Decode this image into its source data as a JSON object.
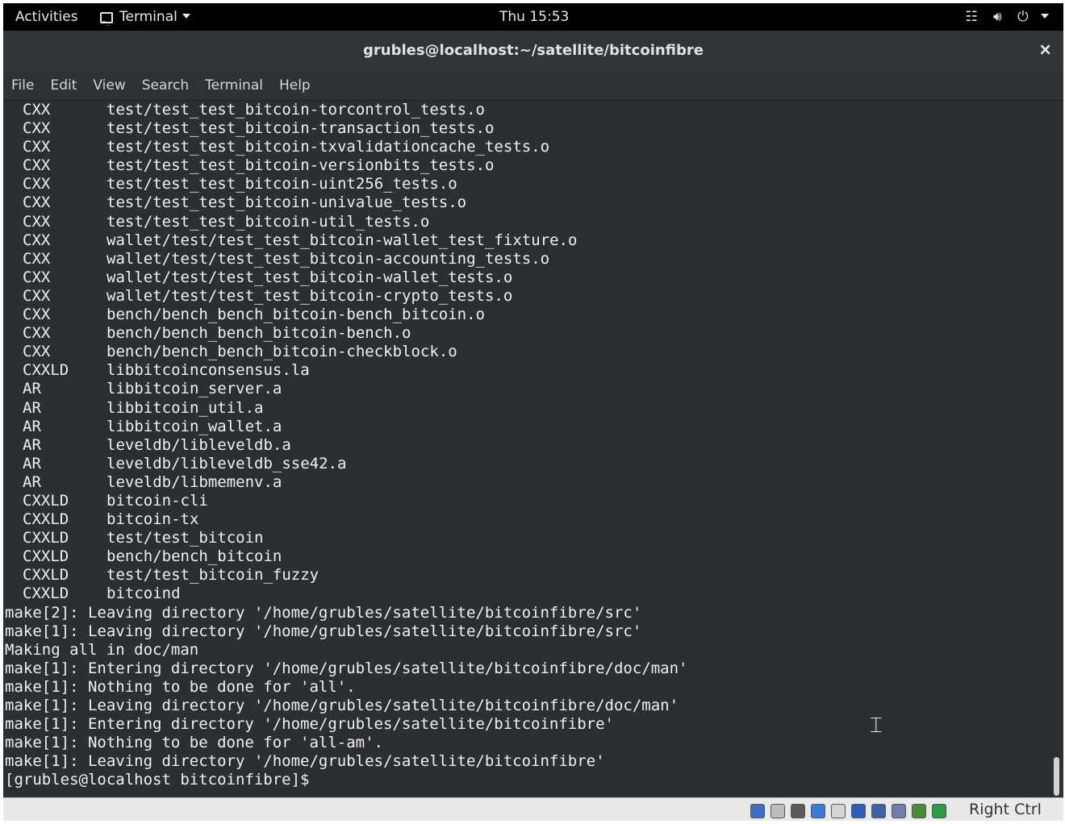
{
  "topbar": {
    "activities": "Activities",
    "app_menu": "Terminal",
    "clock": "Thu 15:53",
    "icons": [
      "network-icon",
      "volume-icon",
      "power-icon",
      "caret-down-icon"
    ]
  },
  "window": {
    "title": "grubles@localhost:~/satellite/bitcoinfibre",
    "close_symbol": "×"
  },
  "menu": [
    "File",
    "Edit",
    "View",
    "Search",
    "Terminal",
    "Help"
  ],
  "build_lines": [
    {
      "tag": "CXX",
      "path": "test/test_test_bitcoin-torcontrol_tests.o"
    },
    {
      "tag": "CXX",
      "path": "test/test_test_bitcoin-transaction_tests.o"
    },
    {
      "tag": "CXX",
      "path": "test/test_test_bitcoin-txvalidationcache_tests.o"
    },
    {
      "tag": "CXX",
      "path": "test/test_test_bitcoin-versionbits_tests.o"
    },
    {
      "tag": "CXX",
      "path": "test/test_test_bitcoin-uint256_tests.o"
    },
    {
      "tag": "CXX",
      "path": "test/test_test_bitcoin-univalue_tests.o"
    },
    {
      "tag": "CXX",
      "path": "test/test_test_bitcoin-util_tests.o"
    },
    {
      "tag": "CXX",
      "path": "wallet/test/test_test_bitcoin-wallet_test_fixture.o"
    },
    {
      "tag": "CXX",
      "path": "wallet/test/test_test_bitcoin-accounting_tests.o"
    },
    {
      "tag": "CXX",
      "path": "wallet/test/test_test_bitcoin-wallet_tests.o"
    },
    {
      "tag": "CXX",
      "path": "wallet/test/test_test_bitcoin-crypto_tests.o"
    },
    {
      "tag": "CXX",
      "path": "bench/bench_bench_bitcoin-bench_bitcoin.o"
    },
    {
      "tag": "CXX",
      "path": "bench/bench_bench_bitcoin-bench.o"
    },
    {
      "tag": "CXX",
      "path": "bench/bench_bench_bitcoin-checkblock.o"
    },
    {
      "tag": "CXXLD",
      "path": "libbitcoinconsensus.la"
    },
    {
      "tag": "AR",
      "path": "libbitcoin_server.a"
    },
    {
      "tag": "AR",
      "path": "libbitcoin_util.a"
    },
    {
      "tag": "AR",
      "path": "libbitcoin_wallet.a"
    },
    {
      "tag": "AR",
      "path": "leveldb/libleveldb.a"
    },
    {
      "tag": "AR",
      "path": "leveldb/libleveldb_sse42.a"
    },
    {
      "tag": "AR",
      "path": "leveldb/libmemenv.a"
    },
    {
      "tag": "CXXLD",
      "path": "bitcoin-cli"
    },
    {
      "tag": "CXXLD",
      "path": "bitcoin-tx"
    },
    {
      "tag": "CXXLD",
      "path": "test/test_bitcoin"
    },
    {
      "tag": "CXXLD",
      "path": "bench/bench_bitcoin"
    },
    {
      "tag": "CXXLD",
      "path": "test/test_bitcoin_fuzzy"
    },
    {
      "tag": "CXXLD",
      "path": "bitcoind"
    }
  ],
  "make_lines": [
    "make[2]: Leaving directory '/home/grubles/satellite/bitcoinfibre/src'",
    "make[1]: Leaving directory '/home/grubles/satellite/bitcoinfibre/src'",
    "Making all in doc/man",
    "make[1]: Entering directory '/home/grubles/satellite/bitcoinfibre/doc/man'",
    "make[1]: Nothing to be done for 'all'.",
    "make[1]: Leaving directory '/home/grubles/satellite/bitcoinfibre/doc/man'",
    "make[1]: Entering directory '/home/grubles/satellite/bitcoinfibre'",
    "make[1]: Nothing to be done for 'all-am'.",
    "make[1]: Leaving directory '/home/grubles/satellite/bitcoinfibre'"
  ],
  "prompt": "[grubles@localhost bitcoinfibre]$",
  "vbox": {
    "host_key": "Right Ctrl",
    "icons": [
      {
        "name": "hard-disk-icon",
        "color": "#3a6fc4"
      },
      {
        "name": "optical-drive-icon",
        "color": "#bdbdbd"
      },
      {
        "name": "network-adapters-icon",
        "color": "#5a5a5a"
      },
      {
        "name": "usb-icon",
        "color": "#3b7bd6"
      },
      {
        "name": "shared-folders-icon",
        "color": "#d6d6d6"
      },
      {
        "name": "display-icon",
        "color": "#2c5fb8"
      },
      {
        "name": "video-capture-icon",
        "color": "#3e64a8"
      },
      {
        "name": "guest-additions-icon",
        "color": "#6f7fa8"
      },
      {
        "name": "mouse-integration-icon",
        "color": "#4a8a3a"
      },
      {
        "name": "keyboard-capture-icon",
        "color": "#2f9a45"
      }
    ]
  }
}
